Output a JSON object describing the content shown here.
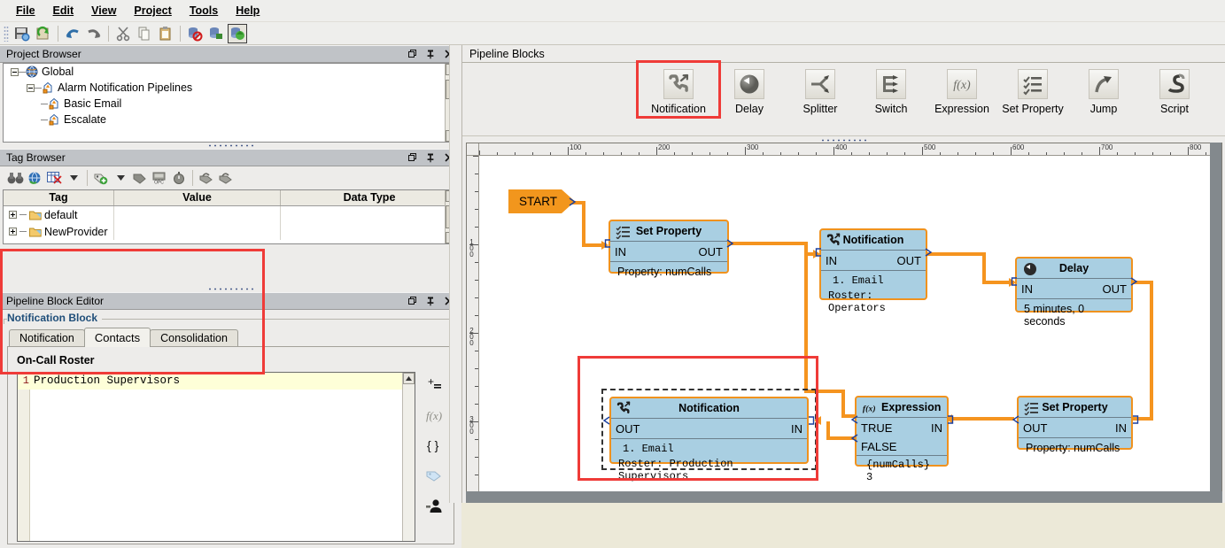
{
  "menubar": {
    "items": [
      {
        "label": "File",
        "mnemonic": "F"
      },
      {
        "label": "Edit",
        "mnemonic": "E"
      },
      {
        "label": "View",
        "mnemonic": "V"
      },
      {
        "label": "Project",
        "mnemonic": "P"
      },
      {
        "label": "Tools",
        "mnemonic": "T"
      },
      {
        "label": "Help",
        "mnemonic": "H"
      }
    ]
  },
  "toolbar": {
    "buttons": [
      {
        "name": "save-icon"
      },
      {
        "name": "refresh-icon"
      },
      {
        "name": "undo-icon"
      },
      {
        "name": "redo-icon"
      },
      {
        "name": "cut-icon"
      },
      {
        "name": "copy-icon"
      },
      {
        "name": "paste-icon"
      },
      {
        "name": "database-disabled-icon"
      },
      {
        "name": "database-connect-icon"
      },
      {
        "name": "database-sync-icon"
      }
    ]
  },
  "project_browser": {
    "title": "Project Browser",
    "tree": [
      {
        "label": "Global",
        "level": 0,
        "icon": "globe-icon",
        "expanded": true
      },
      {
        "label": "Alarm Notification Pipelines",
        "level": 1,
        "icon": "pipeline-icon",
        "expanded": true
      },
      {
        "label": "Basic Email",
        "level": 2,
        "icon": "pipeline-icon",
        "expanded": false
      },
      {
        "label": "Escalate",
        "level": 2,
        "icon": "pipeline-icon",
        "expanded": false
      }
    ]
  },
  "tag_browser": {
    "title": "Tag Browser",
    "toolbar": [
      {
        "name": "binoculars-icon"
      },
      {
        "name": "tag-globe-icon"
      },
      {
        "name": "tag-table-icon"
      },
      {
        "name": "dropdown-arrow-icon"
      },
      {
        "name": "new-tag-icon"
      },
      {
        "name": "dropdown-arrow-2-icon"
      },
      {
        "name": "tag-label-icon"
      },
      {
        "name": "opc-icon"
      },
      {
        "name": "clock-icon"
      },
      {
        "name": "import-icon"
      },
      {
        "name": "export-icon"
      }
    ],
    "columns": [
      "Tag",
      "Value",
      "Data Type"
    ],
    "rows": [
      {
        "tag": "default",
        "value": "",
        "data_type": ""
      },
      {
        "tag": "NewProvider",
        "value": "",
        "data_type": ""
      }
    ]
  },
  "block_editor": {
    "title": "Pipeline Block Editor",
    "group_label": "Notification Block",
    "tabs": [
      {
        "label": "Notification",
        "active": false
      },
      {
        "label": "Contacts",
        "active": true
      },
      {
        "label": "Consolidation",
        "active": false
      }
    ],
    "section_label": "On-Call Roster",
    "roster": {
      "line_number": "1",
      "text": "Production Supervisors"
    },
    "side_tools": [
      {
        "name": "add-row-icon",
        "glyph": "+"
      },
      {
        "name": "expression-fx-icon",
        "glyph": "f(x)"
      },
      {
        "name": "braces-icon",
        "glyph": "{ }"
      },
      {
        "name": "tag-browse-icon",
        "glyph": "tag"
      },
      {
        "name": "user-select-icon",
        "glyph": "user"
      }
    ]
  },
  "pipeline_blocks_panel": {
    "title": "Pipeline Blocks",
    "items": [
      {
        "label": "Notification",
        "icon": "phone-notification-icon",
        "highlighted": true
      },
      {
        "label": "Delay",
        "icon": "clock-delay-icon",
        "highlighted": false
      },
      {
        "label": "Splitter",
        "icon": "splitter-icon",
        "highlighted": false
      },
      {
        "label": "Switch",
        "icon": "switch-icon",
        "highlighted": false
      },
      {
        "label": "Expression",
        "icon": "fx-icon",
        "highlighted": false
      },
      {
        "label": "Set Property",
        "icon": "checklist-icon",
        "highlighted": false
      },
      {
        "label": "Jump",
        "icon": "jump-arrow-icon",
        "highlighted": false
      },
      {
        "label": "Script",
        "icon": "script-icon",
        "highlighted": false
      }
    ]
  },
  "canvas": {
    "ruler_h_labels": [
      "100",
      "200",
      "300",
      "400",
      "500",
      "600",
      "700",
      "800"
    ],
    "ruler_v_labels": [
      "100",
      "200",
      "300"
    ],
    "start_label": "START",
    "nodes": [
      {
        "id": "set-property-1",
        "title": "Set Property",
        "icon": "checklist-icon",
        "left_port": "IN",
        "right_port": "OUT",
        "body": [
          "Property: numCalls"
        ]
      },
      {
        "id": "notification-operators",
        "title": "Notification",
        "icon": "phone-notification-icon",
        "left_port": "IN",
        "right_port": "OUT",
        "body": [
          "1. Email",
          "Roster: Operators"
        ]
      },
      {
        "id": "delay-1",
        "title": "Delay",
        "icon": "clock-delay-icon",
        "left_port": "IN",
        "right_port": "OUT",
        "body": [
          "5 minutes, 0 seconds"
        ]
      },
      {
        "id": "set-property-2",
        "title": "Set Property",
        "icon": "checklist-icon",
        "left_port": "OUT",
        "right_port": "IN",
        "body": [
          "Property:  numCalls"
        ]
      },
      {
        "id": "expression-1",
        "title": "Expression",
        "icon": "fx-icon",
        "left_port": "TRUE",
        "left_port_2": "FALSE",
        "right_port": "IN",
        "body": [
          "{numCalls} 3"
        ]
      },
      {
        "id": "notification-production-supervisors",
        "title": "Notification",
        "icon": "phone-notification-icon",
        "left_port": "OUT",
        "right_port": "IN",
        "body": [
          "1. Email",
          "Roster: Production Supervisors"
        ],
        "selected": true
      }
    ]
  },
  "colors": {
    "highlight": "#ef3b38",
    "node_fill": "#a9cfe2",
    "node_border": "#f0921e",
    "connector": "#f5941f",
    "start_fill": "#f2961d",
    "panel_title_bg": "#c0c3c7"
  }
}
